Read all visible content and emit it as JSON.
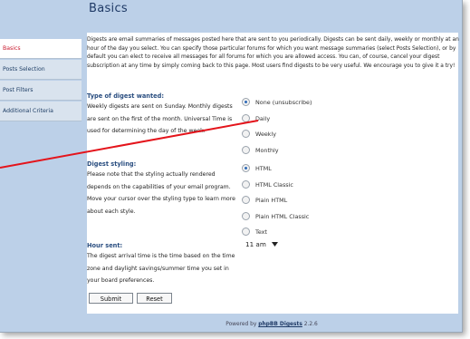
{
  "page": {
    "title": "Basics"
  },
  "sidebar": {
    "items": [
      {
        "label": "Basics"
      },
      {
        "label": "Posts Selection"
      },
      {
        "label": "Post Filters"
      },
      {
        "label": "Additional Criteria"
      }
    ]
  },
  "intro": "Digests are email summaries of messages posted here that are sent to you periodically. Digests can be sent daily, weekly or monthly at an hour of the day you select. You can specify those particular forums for which you want message summaries (select Posts Selection), or by default you can elect to receive all messages for all forums for which you are allowed access. You can, of course, cancel your digest subscription at any time by simply coming back to this page. Most users find digests to be very useful. We encourage you to give it a try!",
  "digest_type": {
    "title": "Type of digest wanted:",
    "text": "Weekly digests are sent on Sunday. Monthly digests are sent on the first of the month. Universal Time is used for determining the day of the week.",
    "options": [
      {
        "label": "None (unsubscribe)",
        "checked": true
      },
      {
        "label": "Daily",
        "checked": false
      },
      {
        "label": "Weekly",
        "checked": false
      },
      {
        "label": "Monthly",
        "checked": false
      }
    ]
  },
  "digest_styling": {
    "title": "Digest styling:",
    "text": "Please note that the styling actually rendered depends on the capabilities of your email program. Move your cursor over the styling type to learn more about each style.",
    "options": [
      {
        "label": "HTML",
        "checked": true
      },
      {
        "label": "HTML Classic",
        "checked": false
      },
      {
        "label": "Plain HTML",
        "checked": false
      },
      {
        "label": "Plain HTML Classic",
        "checked": false
      },
      {
        "label": "Text",
        "checked": false
      }
    ]
  },
  "hour_sent": {
    "title": "Hour sent:",
    "text": "The digest arrival time is the time based on the time zone and daylight savings/summer time you set in your board preferences.",
    "value": "11 am"
  },
  "buttons": {
    "submit": "Submit",
    "reset": "Reset"
  },
  "footer": {
    "prefix": "Powered by",
    "link": "phpBB Digests",
    "version": "2.2.6"
  },
  "colors": {
    "frame_bg": "#bcd0e8",
    "title": "#1f3a66",
    "section_title": "#2a4e80",
    "active_tab_text": "#c8162b",
    "annotation_line": "#e4141b"
  }
}
